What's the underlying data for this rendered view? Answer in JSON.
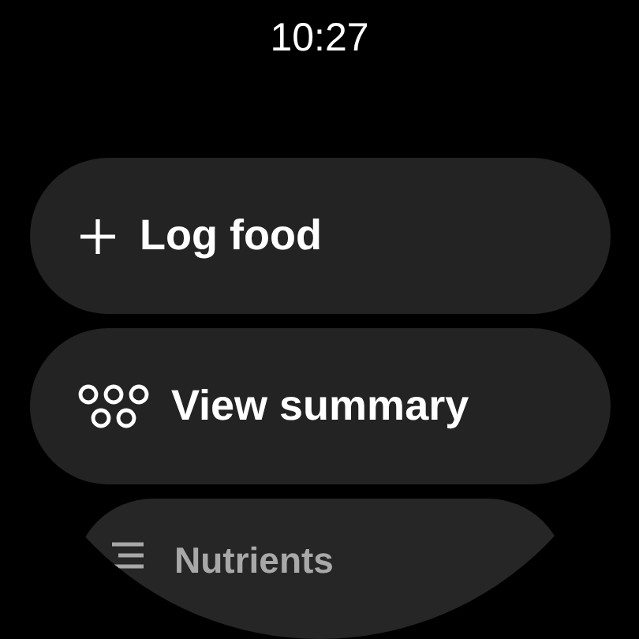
{
  "time": "10:27",
  "chips": [
    {
      "label": "Log food",
      "kind": "plus",
      "faded": false
    },
    {
      "label": "View summary",
      "kind": "dots",
      "faded": false
    },
    {
      "label": "Nutrients",
      "kind": "lines",
      "faded": true
    }
  ]
}
